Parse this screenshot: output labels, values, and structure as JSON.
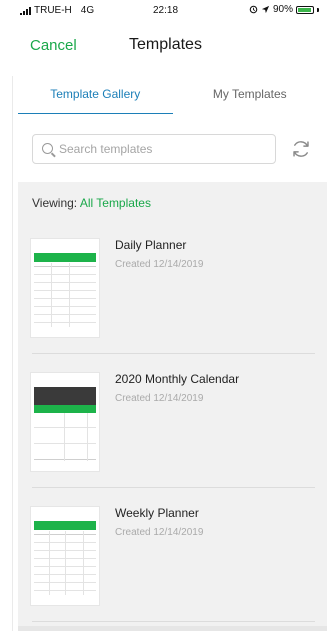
{
  "status_bar": {
    "carrier": "TRUE-H",
    "network": "4G",
    "time": "22:18",
    "battery_percent": "90%",
    "battery_level": 0.9
  },
  "nav": {
    "cancel_label": "Cancel",
    "title": "Templates"
  },
  "tabs": [
    {
      "label": "Template Gallery",
      "active": true
    },
    {
      "label": "My Templates",
      "active": false
    }
  ],
  "search": {
    "placeholder": "Search templates",
    "value": ""
  },
  "viewing": {
    "prefix": "Viewing:",
    "filter": "All Templates"
  },
  "templates": [
    {
      "name": "Daily Planner",
      "created": "Created 12/14/2019"
    },
    {
      "name": "2020 Monthly Calendar",
      "created": "Created 12/14/2019"
    },
    {
      "name": "Weekly Planner",
      "created": "Created 12/14/2019"
    }
  ],
  "colors": {
    "accent_green": "#1aa84a",
    "tab_blue": "#1c7fb8",
    "gallery_bg": "#f1f1f1"
  }
}
